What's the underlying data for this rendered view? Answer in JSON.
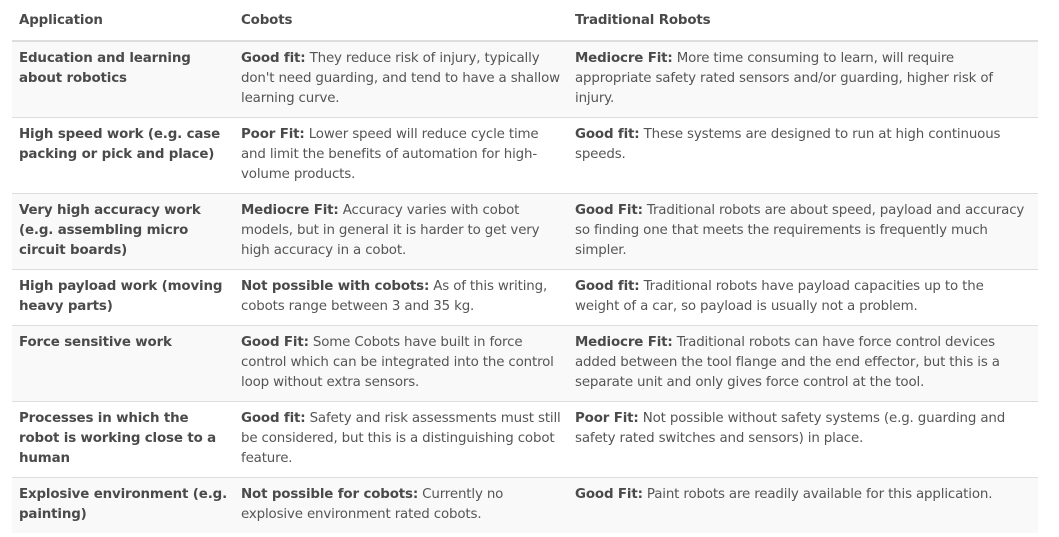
{
  "table": {
    "headers": [
      "Application",
      "Cobots",
      "Traditional Robots"
    ],
    "rows": [
      {
        "application": "Education and learning about robotics",
        "cobots": {
          "verdict": "Good fit:",
          "text": " They reduce risk of injury, typically don't need guarding, and tend to have a shallow learning curve."
        },
        "traditional": {
          "verdict": "Mediocre Fit:",
          "text": " More time consuming to learn, will require appropriate safety rated sensors and/or guarding, higher risk of injury."
        }
      },
      {
        "application": "High speed work (e.g. case packing or pick and place)",
        "cobots": {
          "verdict": "Poor Fit:",
          "text": " Lower speed will reduce cycle time and limit the benefits of automation for high-volume products."
        },
        "traditional": {
          "verdict": "Good fit:",
          "text": " These systems are designed to run at high continuous speeds."
        }
      },
      {
        "application": "Very high accuracy work (e.g. assembling micro circuit boards)",
        "cobots": {
          "verdict": "Mediocre Fit:",
          "text": " Accuracy varies with cobot models, but in general it is harder to get very high accuracy in a cobot."
        },
        "traditional": {
          "verdict": "Good Fit:",
          "text": " Traditional robots are about speed, payload and accuracy so finding one that meets the requirements is frequently much simpler."
        }
      },
      {
        "application": "High payload work (moving heavy parts)",
        "cobots": {
          "verdict": "Not possible with cobots:",
          "text": " As of this writing, cobots range between 3 and 35 kg."
        },
        "traditional": {
          "verdict": "Good fit:",
          "text": " Traditional robots have payload capacities up to the weight of a car, so payload is usually not a problem."
        }
      },
      {
        "application": "Force sensitive work",
        "cobots": {
          "verdict": "Good Fit:",
          "text": " Some Cobots have built in force control which can be integrated into the control loop without extra sensors."
        },
        "traditional": {
          "verdict": "Mediocre Fit:",
          "text": " Traditional robots can have force control devices added between the tool flange and the end effector, but this is a separate unit and only gives force control at the tool."
        }
      },
      {
        "application": "Processes in which the robot is working close to a human",
        "cobots": {
          "verdict": "Good fit:",
          "text": " Safety and risk assessments must still be considered, but this is a distinguishing cobot feature."
        },
        "traditional": {
          "verdict": "Poor Fit:",
          "text": " Not possible without safety systems (e.g. guarding and safety rated switches and sensors) in place."
        }
      },
      {
        "application": "Explosive environment (e.g. painting)",
        "cobots": {
          "verdict": "Not possible for cobots:",
          "text": " Currently no explosive environment rated cobots."
        },
        "traditional": {
          "verdict": "Good Fit:",
          "text": " Paint robots are readily available for this application."
        }
      }
    ]
  }
}
